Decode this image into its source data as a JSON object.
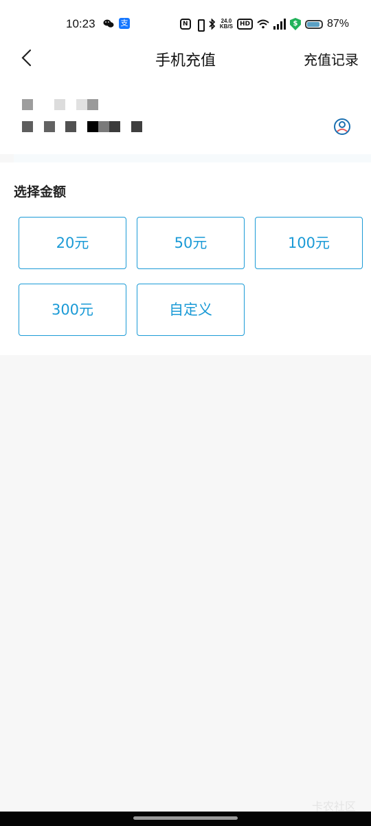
{
  "status_bar": {
    "time": "10:23",
    "speed_top": "24.0",
    "speed_bottom": "KB/S",
    "hd_label": "HD",
    "battery_percent": "87%"
  },
  "header": {
    "title": "手机充值",
    "records_label": "充值记录"
  },
  "amounts": {
    "section_title": "选择金额",
    "options": [
      "20元",
      "50元",
      "100元",
      "300元",
      "自定义"
    ]
  },
  "watermark": "卡农社区",
  "colors": {
    "accent": "#1a9ad6",
    "background": "#f7f7f7",
    "nav_bar": "#050505"
  }
}
